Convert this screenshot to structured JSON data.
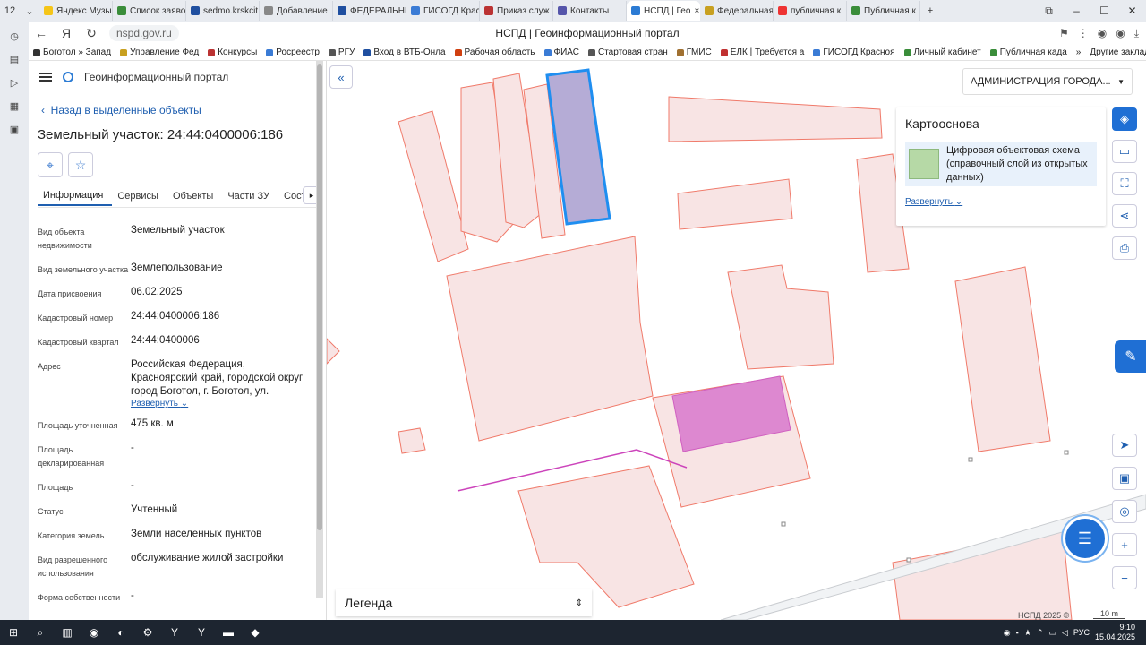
{
  "browser": {
    "tab_count": "12",
    "tabs": [
      {
        "label": "Яндекс Музыка",
        "color": "#f5c518"
      },
      {
        "label": "Список заявок",
        "color": "#3a8d3a"
      },
      {
        "label": "sedmo.krskcit",
        "color": "#1f4fa0"
      },
      {
        "label": "Добавление",
        "color": "#888"
      },
      {
        "label": "ФЕДЕРАЛЬНЫЙ",
        "color": "#1f4fa0"
      },
      {
        "label": "ГИСОГД Красн",
        "color": "#3a7bd5"
      },
      {
        "label": "Приказ служ",
        "color": "#b33"
      },
      {
        "label": "Контакты",
        "color": "#55a"
      },
      {
        "label": "НСПД | Гео",
        "color": "#2b7bd4"
      },
      {
        "label": "Федеральная",
        "color": "#c8a020"
      },
      {
        "label": "публичная к",
        "color": "#e33"
      },
      {
        "label": "Публичная к",
        "color": "#3a8d3a"
      }
    ],
    "url": "nspd.gov.ru",
    "page_title": "НСПД | Геоинформационный портал",
    "bookmarks": [
      {
        "label": "Боготол » Запад",
        "color": "#333"
      },
      {
        "label": "Управление Фед",
        "color": "#c8a020"
      },
      {
        "label": "Конкурсы",
        "color": "#b33"
      },
      {
        "label": "Росреестр",
        "color": "#3a7bd5"
      },
      {
        "label": "РГУ",
        "color": "#555"
      },
      {
        "label": "Вход в ВТБ-Онла",
        "color": "#1f4fa0"
      },
      {
        "label": "Рабочая область",
        "color": "#d04010"
      },
      {
        "label": "ФИАС",
        "color": "#3a7bd5"
      },
      {
        "label": "Стартовая стран",
        "color": "#555"
      },
      {
        "label": "ГМИС",
        "color": "#a07030"
      },
      {
        "label": "ЕЛК | Требуется а",
        "color": "#c03030"
      },
      {
        "label": "ГИСОГД Красноя",
        "color": "#3a7bd5"
      },
      {
        "label": "Личный кабинет",
        "color": "#3a8d3a"
      },
      {
        "label": "Публичная када",
        "color": "#3a8d3a"
      }
    ],
    "other_bookmarks": "Другие закладки"
  },
  "portal": {
    "name": "Геоинформационный портал",
    "back_link": "Назад в выделенные объекты",
    "object_title": "Земельный участок: 24:44:0400006:186",
    "tabs": [
      "Информация",
      "Сервисы",
      "Объекты",
      "Части ЗУ",
      "Соста"
    ],
    "properties": [
      {
        "key": "Вид объекта недвижимости",
        "value": "Земельный участок"
      },
      {
        "key": "Вид земельного участка",
        "value": "Землепользование"
      },
      {
        "key": "Дата присвоения",
        "value": "06.02.2025"
      },
      {
        "key": "Кадастровый номер",
        "value": "24:44:0400006:186"
      },
      {
        "key": "Кадастровый квартал",
        "value": "24:44:0400006"
      },
      {
        "key": "Адрес",
        "value": "Российская Федерация, Красноярский край, городской округ город Боготол, г. Боготол, ул."
      },
      {
        "key": "Площадь уточненная",
        "value": "475 кв. м"
      },
      {
        "key": "Площадь декларированная",
        "value": "-"
      },
      {
        "key": "Площадь",
        "value": "-"
      },
      {
        "key": "Статус",
        "value": "Учтенный"
      },
      {
        "key": "Категория земель",
        "value": "Земли населенных пунктов"
      },
      {
        "key": "Вид разрешенного использования",
        "value": "обслуживание жилой застройки"
      },
      {
        "key": "Форма собственности",
        "value": "-"
      }
    ],
    "expand_label": "Развернуть"
  },
  "map": {
    "admin_select": "АДМИНИСТРАЦИЯ ГОРОДА...",
    "basemap_title": "Картооснова",
    "basemap_item": "Цифровая объектовая схема (справочный слой из открытых данных)",
    "basemap_expand": "Развернуть",
    "legend": "Легенда",
    "copyright": "НСПД 2025 ©",
    "scale": "10 m",
    "parcel_fill": "#f8e4e4",
    "parcel_stroke": "#f07a6a",
    "selected_fill": "#b5acd6",
    "selected_stroke": "#1f8ef0",
    "highlight_fill": "#dd88d0"
  },
  "taskbar": {
    "lang": "РУС",
    "time": "9:10",
    "date": "15.04.2025"
  }
}
